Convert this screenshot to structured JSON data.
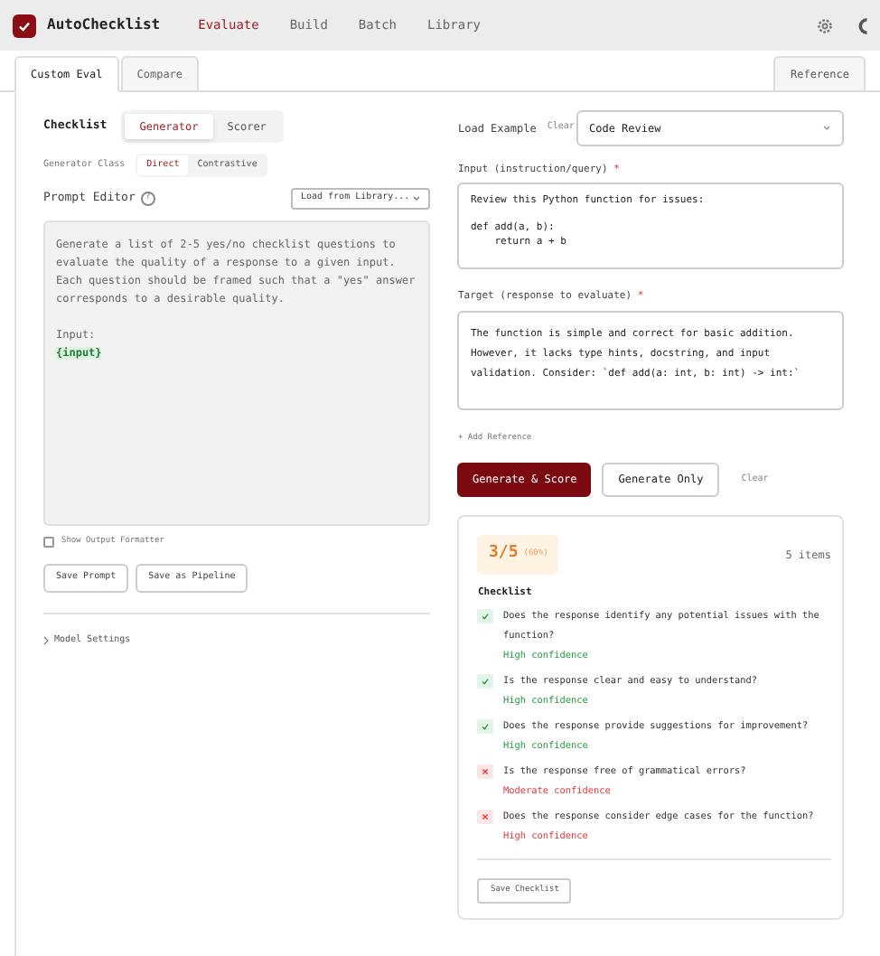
{
  "app": {
    "title": "AutoChecklist"
  },
  "nav": [
    {
      "label": "Evaluate",
      "selected": true
    },
    {
      "label": "Build",
      "selected": false
    },
    {
      "label": "Batch",
      "selected": false
    },
    {
      "label": "Library",
      "selected": false
    }
  ],
  "tabs": [
    {
      "label": "Custom Eval",
      "selected": true
    },
    {
      "label": "Compare",
      "selected": false
    }
  ],
  "side_tab": {
    "label": "Reference"
  },
  "left": {
    "checklist_label": "Checklist",
    "modes": [
      {
        "label": "Generator",
        "selected": true
      },
      {
        "label": "Scorer",
        "selected": false
      }
    ],
    "class_label": "Generator Class",
    "classes": [
      {
        "label": "Direct",
        "selected": true
      },
      {
        "label": "Contrastive",
        "selected": false
      }
    ],
    "prompt_label": "Prompt Editor",
    "help": "?",
    "library_select": "Load from Library...",
    "prompt_text": "Generate a list of 2-5 yes/no checklist questions to evaluate the quality of a response to a given input. Each question should be framed such that a \"yes\" answer corresponds to a desirable quality.",
    "input_label": "Input:",
    "variable": "{input}",
    "formatter": {
      "label": "Show Output Formatter",
      "checked": false
    },
    "buttons": [
      "Save Prompt",
      "Save as Pipeline"
    ],
    "model_settings": {
      "label": "Model Settings",
      "expanded": false
    }
  },
  "right": {
    "example_label": "Load Example",
    "example_clear": "Clear",
    "example_select": "Code Review",
    "input_label": "Input (instruction/query)",
    "input_value": "Review this Python function for issues:\n\ndef add(a, b):\n    return a + b",
    "target_label": "Target (response to evaluate)",
    "target_value": "The function is simple and correct for basic addition. However, it lacks type hints, docstring, and input validation. Consider: `def add(a: int, b: int) -> int:`",
    "required": "*",
    "add_reference": "+ Add Reference",
    "primary_button": "Generate & Score",
    "secondary_button": "Generate Only",
    "clear": "Clear"
  },
  "result": {
    "score": "3/5",
    "percent": "(60%)",
    "count": "5 items",
    "heading": "Checklist",
    "items": [
      {
        "question": "Does the response identify any potential issues with the function?",
        "passed": true,
        "confidence": "High confidence"
      },
      {
        "question": "Is the response clear and easy to understand?",
        "passed": true,
        "confidence": "High confidence"
      },
      {
        "question": "Does the response provide suggestions for improvement?",
        "passed": true,
        "confidence": "High confidence"
      },
      {
        "question": "Is the response free of grammatical errors?",
        "passed": false,
        "confidence": "Moderate confidence"
      },
      {
        "question": "Does the response consider edge cases for the function?",
        "passed": false,
        "confidence": "High confidence"
      }
    ],
    "save_button": "Save Checklist"
  }
}
